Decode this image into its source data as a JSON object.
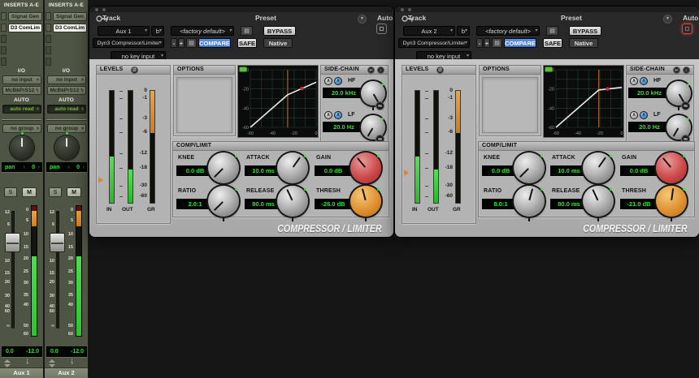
{
  "icons": {
    "phase": "Ø",
    "preset_menu": "▼",
    "auto_window": "▤",
    "copy": "▤",
    "key_arrow": "↩",
    "key_listen": "♪",
    "filter_caret": "∧",
    "hw_insert": "ϟ",
    "down_arrow": "↓"
  },
  "strips": [
    {
      "inserts_header": "INSERTS A-E",
      "insert_1": "Signal Gen",
      "insert_2": "D3 ComLim",
      "io_header": "I/O",
      "input": "no input",
      "output": "McBkPrS12",
      "auto_header": "AUTO",
      "auto_mode": "auto read",
      "group": "no group",
      "pan_label": "pan",
      "pan_value": "0",
      "solo_label": "S",
      "mute_label": "M",
      "fader_scale": [
        "12",
        "6",
        "0",
        "5",
        "10",
        "15",
        "20",
        "30",
        "40",
        "60",
        "∞"
      ],
      "meter_scale": [
        "0",
        "5",
        "10",
        "15",
        "20",
        "25",
        "30",
        "35",
        "40",
        "50",
        "60"
      ],
      "volume": "0.0",
      "peak": "-12.0",
      "name": "Aux 1"
    },
    {
      "inserts_header": "INSERTS A-E",
      "insert_1": "Signal Gen",
      "insert_2": "D3 ComLim",
      "io_header": "I/O",
      "input": "no input",
      "output": "McBkPrS12",
      "auto_header": "AUTO",
      "auto_mode": "auto read",
      "group": "no group",
      "pan_label": "pan",
      "pan_value": "0",
      "solo_label": "S",
      "mute_label": "M",
      "fader_scale": [
        "12",
        "6",
        "0",
        "5",
        "10",
        "15",
        "20",
        "30",
        "40",
        "60",
        "∞"
      ],
      "meter_scale": [
        "0",
        "5",
        "10",
        "15",
        "20",
        "25",
        "30",
        "35",
        "40",
        "50",
        "60"
      ],
      "volume": "0.0",
      "peak": "-12.0",
      "name": "Aux 2"
    }
  ],
  "plugins": [
    {
      "focused": false,
      "header": {
        "track_label": "Track",
        "track_name": "Aux 1",
        "insert_letter": "b",
        "plugin_name": "Dyn3 Compressor/Limiter",
        "preset_label": "Preset",
        "preset_name": "<factory default>",
        "minus": "-",
        "plus": "+",
        "compare": "COMPARE",
        "auto_label": "Auto",
        "safe": "SAFE",
        "bypass": "BYPASS",
        "format": "Native",
        "key_input": "no key input"
      },
      "levels": {
        "label": "LEVELS",
        "scale": [
          "0",
          "-1",
          "-3",
          "-6",
          "-12",
          "-18",
          "-30",
          "-60"
        ],
        "in_label": "IN",
        "out_label": "OUT",
        "gr_label": "GR",
        "in_db": -13,
        "out_db": -18.5,
        "gr_db": -6,
        "marker_db": -26
      },
      "options_label": "OPTIONS",
      "graph": {
        "x_ticks": [
          -60,
          -40,
          -20,
          0
        ],
        "y_ticks": [
          0,
          -20,
          -40,
          -60
        ],
        "threshold_db": -26,
        "ratio": 2,
        "input_db": -13
      },
      "sidechain": {
        "label": "SIDE-CHAIN",
        "hf_label": "HF",
        "hf_value": "20.0 kHz",
        "lf_label": "LF",
        "lf_value": "20.0 Hz",
        "in_label": "IN"
      },
      "complimit": {
        "label": "COMP/LIMIT",
        "knee_label": "KNEE",
        "knee": "0.0 dB",
        "attack_label": "ATTACK",
        "attack": "10.0 ms",
        "gain_label": "GAIN",
        "gain": "0.0 dB",
        "ratio_label": "RATIO",
        "ratio": "2.0:1",
        "release_label": "RELEASE",
        "release": "80.0 ms",
        "thresh_label": "THRESH",
        "thresh": "-26.0 dB"
      },
      "knob_angles": {
        "knee": -135,
        "attack": 35,
        "gain": -40,
        "ratio": -135,
        "release": -25,
        "thresh": -15,
        "hf": 150,
        "lf": -150
      },
      "footer": "COMPRESSOR / LIMITER"
    },
    {
      "focused": true,
      "header": {
        "track_label": "Track",
        "track_name": "Aux 2",
        "insert_letter": "b",
        "plugin_name": "Dyn3 Compressor/Limiter",
        "preset_label": "Preset",
        "preset_name": "<factory default>",
        "minus": "-",
        "plus": "+",
        "compare": "COMPARE",
        "auto_label": "Auto",
        "safe": "SAFE",
        "bypass": "BYPASS",
        "format": "Native",
        "key_input": "no key input"
      },
      "levels": {
        "label": "LEVELS",
        "scale": [
          "0",
          "-1",
          "-3",
          "-6",
          "-12",
          "-18",
          "-30",
          "-60"
        ],
        "in_label": "IN",
        "out_label": "OUT",
        "gr_label": "GR",
        "in_db": -13,
        "out_db": -18.5,
        "gr_db": -6,
        "marker_db": -21
      },
      "options_label": "OPTIONS",
      "graph": {
        "x_ticks": [
          -60,
          -40,
          -20,
          0
        ],
        "y_ticks": [
          0,
          -20,
          -40,
          -60
        ],
        "threshold_db": -21,
        "ratio": 8,
        "input_db": -13
      },
      "sidechain": {
        "label": "SIDE-CHAIN",
        "hf_label": "HF",
        "hf_value": "20.0 kHz",
        "lf_label": "LF",
        "lf_value": "20.0 Hz",
        "in_label": "IN"
      },
      "complimit": {
        "label": "COMP/LIMIT",
        "knee_label": "KNEE",
        "knee": "0.0 dB",
        "attack_label": "ATTACK",
        "attack": "10.0 ms",
        "gain_label": "GAIN",
        "gain": "0.0 dB",
        "ratio_label": "RATIO",
        "ratio": "8.0:1",
        "release_label": "RELEASE",
        "release": "80.0 ms",
        "thresh_label": "THRESH",
        "thresh": "-21.0 dB"
      },
      "knob_angles": {
        "knee": -135,
        "attack": 35,
        "gain": -40,
        "ratio": 15,
        "release": -25,
        "thresh": 8,
        "hf": 150,
        "lf": -150
      },
      "footer": "COMPRESSOR / LIMITER"
    }
  ]
}
